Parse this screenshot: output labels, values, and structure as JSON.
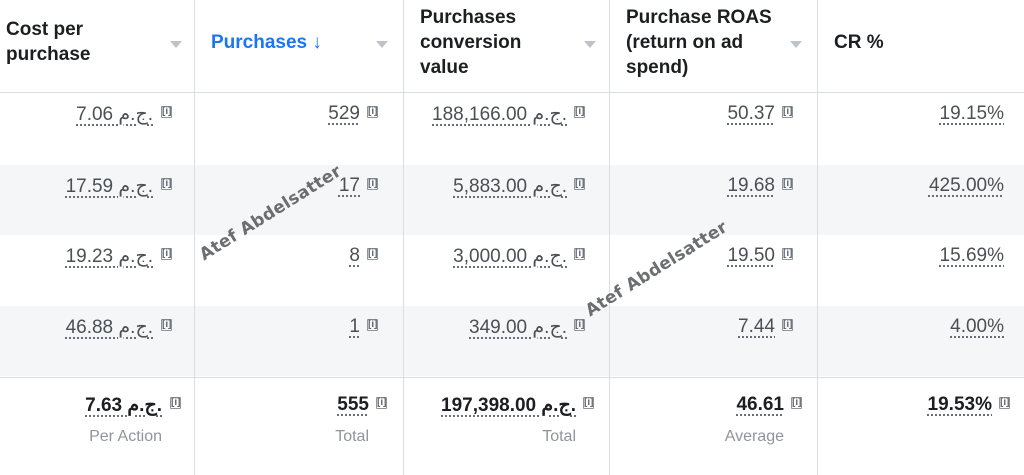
{
  "columns": [
    {
      "label": "Cost per purchase"
    },
    {
      "label": "Purchases ↓"
    },
    {
      "label": "Purchases conversion value"
    },
    {
      "label": "Purchase ROAS (return on ad spend)"
    },
    {
      "label": "CR %"
    }
  ],
  "rows": [
    [
      "7.06 ج.م.",
      "529",
      "188,166.00 ج.م.",
      "50.37",
      "19.15%"
    ],
    [
      "17.59 ج.م.",
      "17",
      "5,883.00 ج.م.",
      "19.68",
      "425.00%"
    ],
    [
      "19.23 ج.م.",
      "8",
      "3,000.00 ج.م.",
      "19.50",
      "15.69%"
    ],
    [
      "46.88 ج.م.",
      "1",
      "349.00 ج.م.",
      "7.44",
      "4.00%"
    ]
  ],
  "totals": [
    "7.63 ج.م.",
    "555",
    "197,398.00 ج.م.",
    "46.61",
    "19.53%"
  ],
  "total_labels": [
    "Per Action",
    "Total",
    "Total",
    "Average",
    ""
  ],
  "info_glyph": "[i]",
  "watermark": "Atef Abdelsatter",
  "colors": {
    "active_header": "#1877f2",
    "stripe": "#f5f6f7",
    "border": "#dadde1"
  }
}
